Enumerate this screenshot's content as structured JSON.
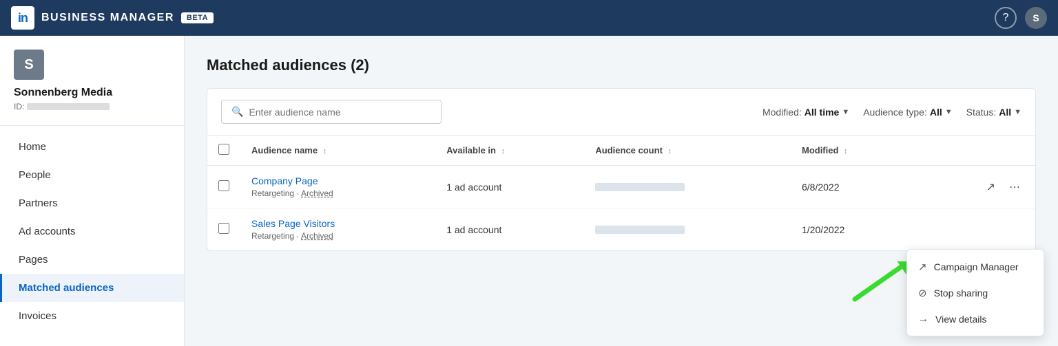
{
  "topnav": {
    "logo_text": "in",
    "title": "BUSINESS MANAGER",
    "beta_label": "BETA",
    "help_icon": "?",
    "user_initial": "S"
  },
  "sidebar": {
    "company_name": "Sonnenberg Media",
    "id_label": "ID:",
    "avatar_initial": "S",
    "nav_items": [
      {
        "label": "Home",
        "active": false
      },
      {
        "label": "People",
        "active": false
      },
      {
        "label": "Partners",
        "active": false
      },
      {
        "label": "Ad accounts",
        "active": false
      },
      {
        "label": "Pages",
        "active": false
      },
      {
        "label": "Matched audiences",
        "active": true
      },
      {
        "label": "Invoices",
        "active": false
      }
    ]
  },
  "main": {
    "page_title": "Matched audiences (2)",
    "search_placeholder": "Enter audience name",
    "filters": {
      "modified_label": "Modified:",
      "modified_value": "All time",
      "audience_type_label": "Audience type:",
      "audience_type_value": "All",
      "status_label": "Status:",
      "status_value": "All"
    },
    "table": {
      "columns": [
        {
          "label": "Audience name",
          "sortable": true
        },
        {
          "label": "Available in",
          "sortable": true
        },
        {
          "label": "Audience count",
          "sortable": true
        },
        {
          "label": "Modified",
          "sortable": true
        }
      ],
      "rows": [
        {
          "name": "Company Page",
          "meta_type": "Retargeting",
          "meta_status": "Archived",
          "available_in": "1 ad account",
          "modified": "6/8/2022"
        },
        {
          "name": "Sales Page Visitors",
          "meta_type": "Retargeting",
          "meta_status": "Archived",
          "available_in": "1 ad account",
          "modified": "1/20/2022"
        }
      ]
    },
    "dropdown_menu": {
      "items": [
        {
          "label": "Campaign Manager",
          "icon": "↗"
        },
        {
          "label": "Stop sharing",
          "icon": "⊘"
        },
        {
          "label": "View details",
          "icon": "→"
        }
      ]
    }
  }
}
